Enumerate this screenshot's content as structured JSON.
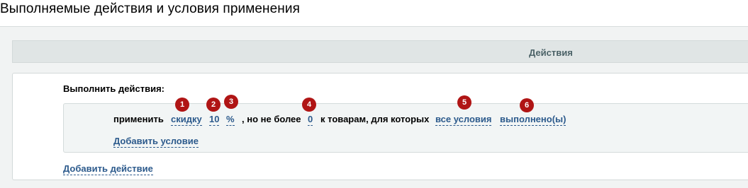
{
  "page": {
    "title": "Выполняемые действия и условия применения"
  },
  "section": {
    "header": "Действия"
  },
  "rule": {
    "execute_label": "Выполнить действия:",
    "action": {
      "apply_text": "применить",
      "discount_type": "скидку",
      "value": "10",
      "unit": "%",
      "but_not_more_text": ", но не более",
      "max_value": "0",
      "for_goods_text": "к товарам, для которых",
      "condition_mode": "все условия",
      "condition_state": "выполнено(ы)",
      "add_condition": "Добавить условие"
    },
    "add_action": "Добавить действие"
  },
  "badges": [
    "1",
    "2",
    "3",
    "4",
    "5",
    "6"
  ],
  "colors": {
    "badge": "#b01515",
    "link": "#2c5a8c",
    "header_text": "#4b6267"
  }
}
